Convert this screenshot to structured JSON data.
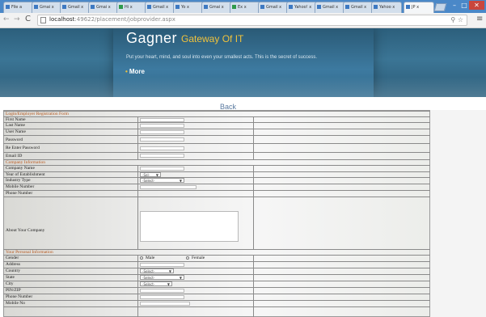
{
  "browser": {
    "tabs": [
      "File a",
      "Gmai x",
      "Gmail x",
      "Gmai x",
      "Hi x",
      "Gmail x",
      "Yo x",
      "Gmai x",
      "Ex x",
      "Gmail x",
      "Yahoo! x",
      "Gmail x",
      "Gmail x",
      "Yahoo x",
      "JP x"
    ],
    "url_host": "localhost",
    "url_path": ":49622/placement/jobprovider.aspx"
  },
  "site": {
    "title": "Gagner",
    "subtitle": "Gateway Of IT",
    "tagline": "Put your heart, mind, and soul into even your smallest acts. This is the secret of success.",
    "more_label": "More"
  },
  "back_label": "Back",
  "form": {
    "section_login": "Login/Employer Registration Form",
    "first_name": "First Name",
    "last_name": "Last Name",
    "user_name": "User Name",
    "password": "Password",
    "re_password": "Re Enter Password",
    "email": "Email ID",
    "section_company": "Company Information",
    "company_name": "Company Name",
    "year_established": "Year of Establishment",
    "industry_type": "Industry Type",
    "mobile": "Mobile Number",
    "phone": "Phone Number",
    "about_company": "About Your Company",
    "section_personal": "Your Personal Information",
    "gender": "Gender",
    "gender_male": "Male",
    "gender_female": "Female",
    "address": "Address",
    "country": "Country",
    "state": "State",
    "city": "City",
    "pin": "PIN/ZIP",
    "phone2": "Phone Number",
    "mobile2": "Mobile No",
    "year_select": "-Sel-",
    "select_default": "-Select-"
  },
  "colors": {
    "header_blue": "#2c5f7c",
    "subtitle_gold": "#f0c23c",
    "section_orange": "#b8581e"
  }
}
